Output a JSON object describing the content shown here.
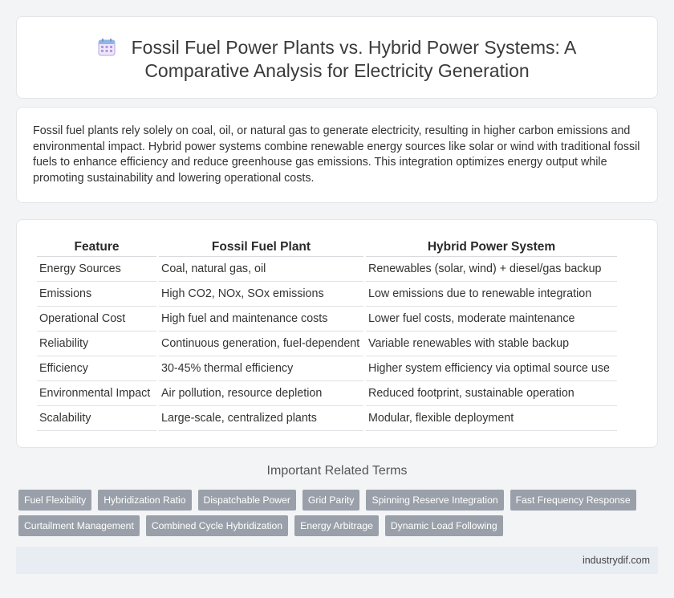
{
  "header": {
    "icon": "calendar-icon",
    "title_line1": "Fossil Fuel Power Plants vs. Hybrid Power Systems: A",
    "title_line2": "Comparative Analysis for Electricity Generation"
  },
  "summary": {
    "text": "Fossil fuel plants rely solely on coal, oil, or natural gas to generate electricity, resulting in higher carbon emissions and environmental impact. Hybrid power systems combine renewable energy sources like solar or wind with traditional fossil fuels to enhance efficiency and reduce greenhouse gas emissions. This integration optimizes energy output while promoting sustainability and lowering operational costs."
  },
  "table": {
    "headers": [
      "Feature",
      "Fossil Fuel Plant",
      "Hybrid Power System"
    ],
    "rows": [
      [
        "Energy Sources",
        "Coal, natural gas, oil",
        "Renewables (solar, wind) + diesel/gas backup"
      ],
      [
        "Emissions",
        "High CO2, NOx, SOx emissions",
        "Low emissions due to renewable integration"
      ],
      [
        "Operational Cost",
        "High fuel and maintenance costs",
        "Lower fuel costs, moderate maintenance"
      ],
      [
        "Reliability",
        "Continuous generation, fuel-dependent",
        "Variable renewables with stable backup"
      ],
      [
        "Efficiency",
        "30-45% thermal efficiency",
        "Higher system efficiency via optimal source use"
      ],
      [
        "Environmental Impact",
        "Air pollution, resource depletion",
        "Reduced footprint, sustainable operation"
      ],
      [
        "Scalability",
        "Large-scale, centralized plants",
        "Modular, flexible deployment"
      ]
    ]
  },
  "related": {
    "title": "Important Related Terms",
    "tags_row1": [
      "Fuel Flexibility",
      "Hybridization Ratio",
      "Dispatchable Power",
      "Grid Parity",
      "Spinning Reserve Integration",
      "Fast Frequency Response"
    ],
    "tags_row2": [
      "Curtailment Management",
      "Combined Cycle Hybridization",
      "Energy Arbitrage",
      "Dynamic Load Following"
    ]
  },
  "footer": {
    "site": "industrydif.com"
  },
  "colors": {
    "tag_bg": "#9aa0a9",
    "footer_bg": "#e8ecf3",
    "icon_accent": "#a78bda"
  }
}
